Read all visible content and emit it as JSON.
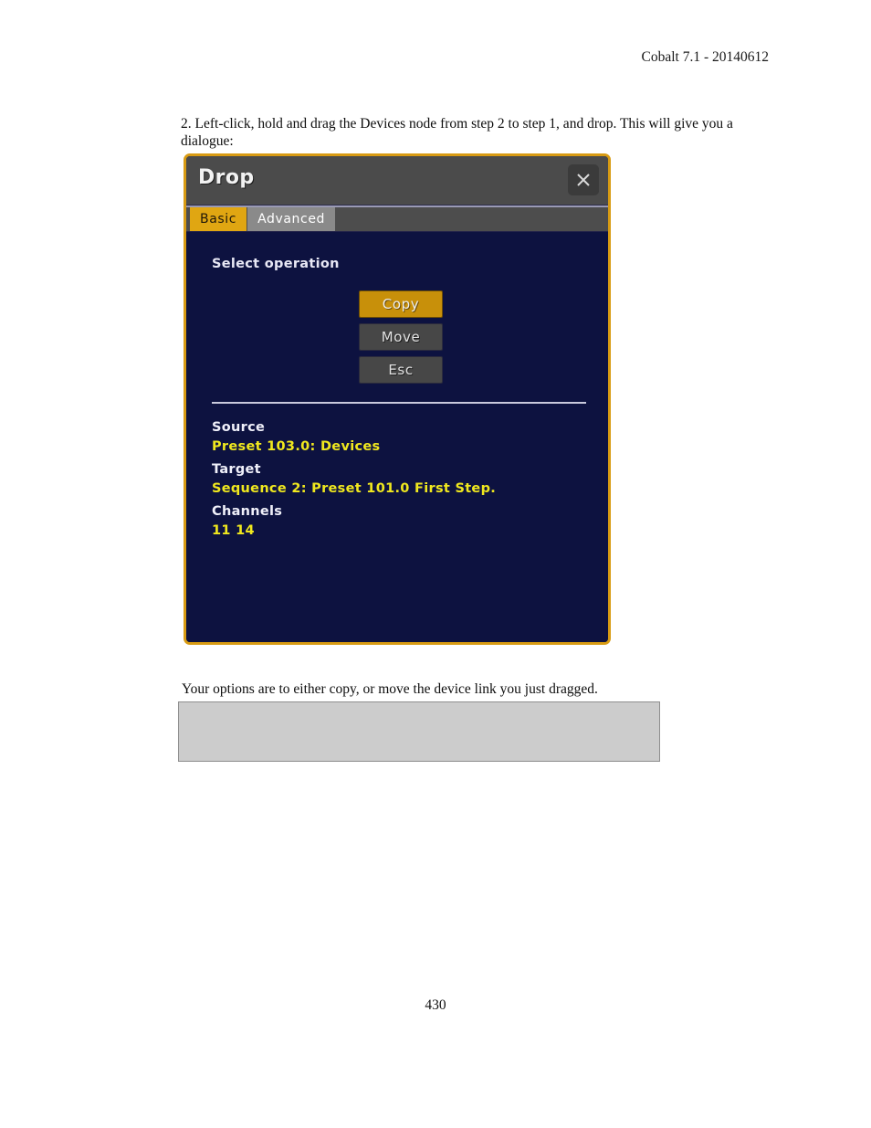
{
  "document": {
    "header": "Cobalt 7.1 - 20140612",
    "step_paragraph": "2. Left-click, hold and drag the Devices node from step 2 to step 1, and drop. This will give you a dialogue:",
    "caption_paragraph": "Your options are to either copy, or move the device link you just dragged.",
    "page_number": "430"
  },
  "dialog": {
    "title": "Drop",
    "close_icon": "close-icon",
    "tabs": [
      {
        "label": "Basic",
        "active": true
      },
      {
        "label": "Advanced",
        "active": false
      }
    ],
    "section_label": "Select operation",
    "buttons": [
      {
        "label": "Copy",
        "style": "primary"
      },
      {
        "label": "Move",
        "style": "secondary"
      },
      {
        "label": "Esc",
        "style": "secondary"
      }
    ],
    "info": {
      "source_label": "Source",
      "source_value": "Preset 103.0: Devices",
      "target_label": "Target",
      "target_value": "Sequence 2: Preset 101.0 First Step.",
      "channels_label": "Channels",
      "channels_value": "11 14"
    },
    "colors": {
      "border": "#d89b13",
      "body_bg": "#0d1240",
      "titlebar_bg": "#4b4b4b",
      "tab_active_bg": "#e0a612",
      "tab_inactive_bg": "#8a8a8a",
      "primary_button_bg": "#c8900a",
      "secondary_button_bg": "#474747",
      "value_text": "#f0e81e",
      "label_text": "#f0f0fa"
    }
  }
}
